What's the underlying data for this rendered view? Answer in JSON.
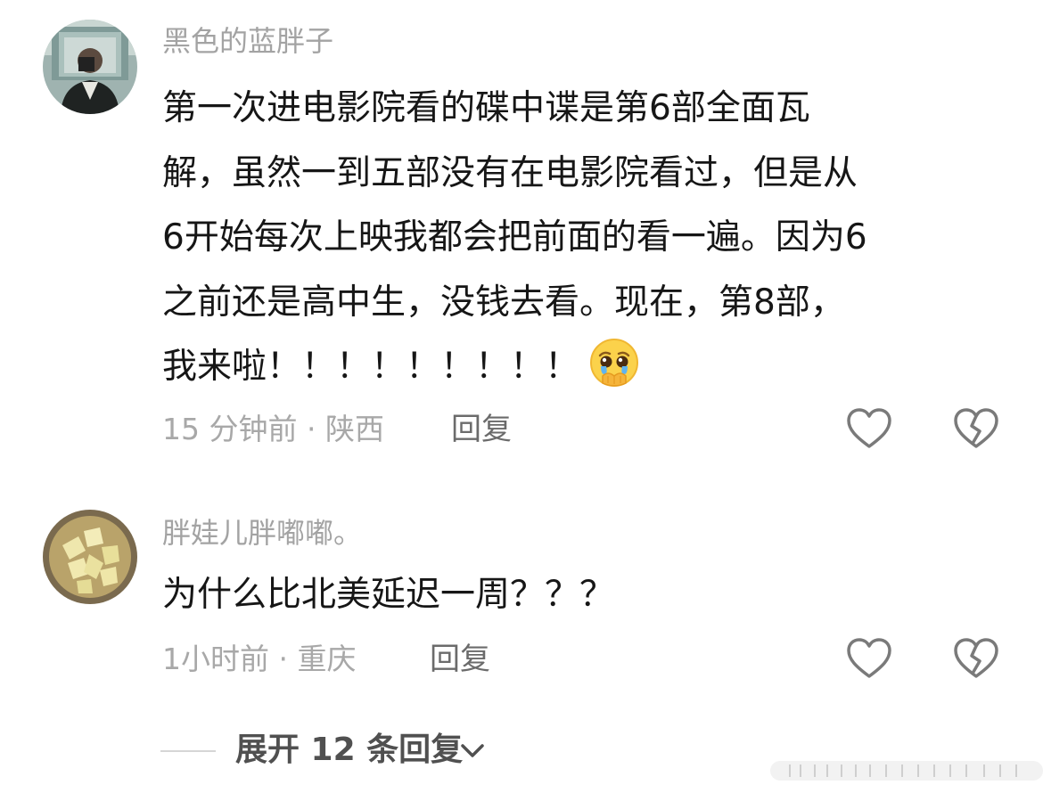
{
  "comments": [
    {
      "username": "黑色的蓝胖子",
      "lines": [
        "第一次进电影院看的碟中谍是第6部全面瓦",
        "解，虽然一到五部没有在电影院看过，但是从",
        "6开始每次上映我都会把前面的看一遍。因为6",
        "之前还是高中生，没钱去看。现在，第8部，",
        "我来啦！！！！！！！！！"
      ],
      "emoji": "pleading-face-with-tears-emoji",
      "time_location": "15 分钟前 · 陕西",
      "reply_label": "回复",
      "avatar": "person-photo-avatar"
    },
    {
      "username": "胖娃儿胖嘟嘟。",
      "lines": [
        "为什么比北美延迟一周？？？"
      ],
      "time_location": "1小时前 · 重庆",
      "reply_label": "回复",
      "avatar": "food-photo-avatar"
    }
  ],
  "expand": {
    "label": "展开 12 条回复"
  },
  "icons": {
    "like": "heart-outline-icon",
    "dislike": "broken-heart-icon",
    "expand": "chevron-down-icon"
  },
  "colors": {
    "username": "#a3a3a3",
    "body": "#161616",
    "meta": "#a8a8a8",
    "reply": "#6b6b6b",
    "icon": "#7a7a7a"
  }
}
